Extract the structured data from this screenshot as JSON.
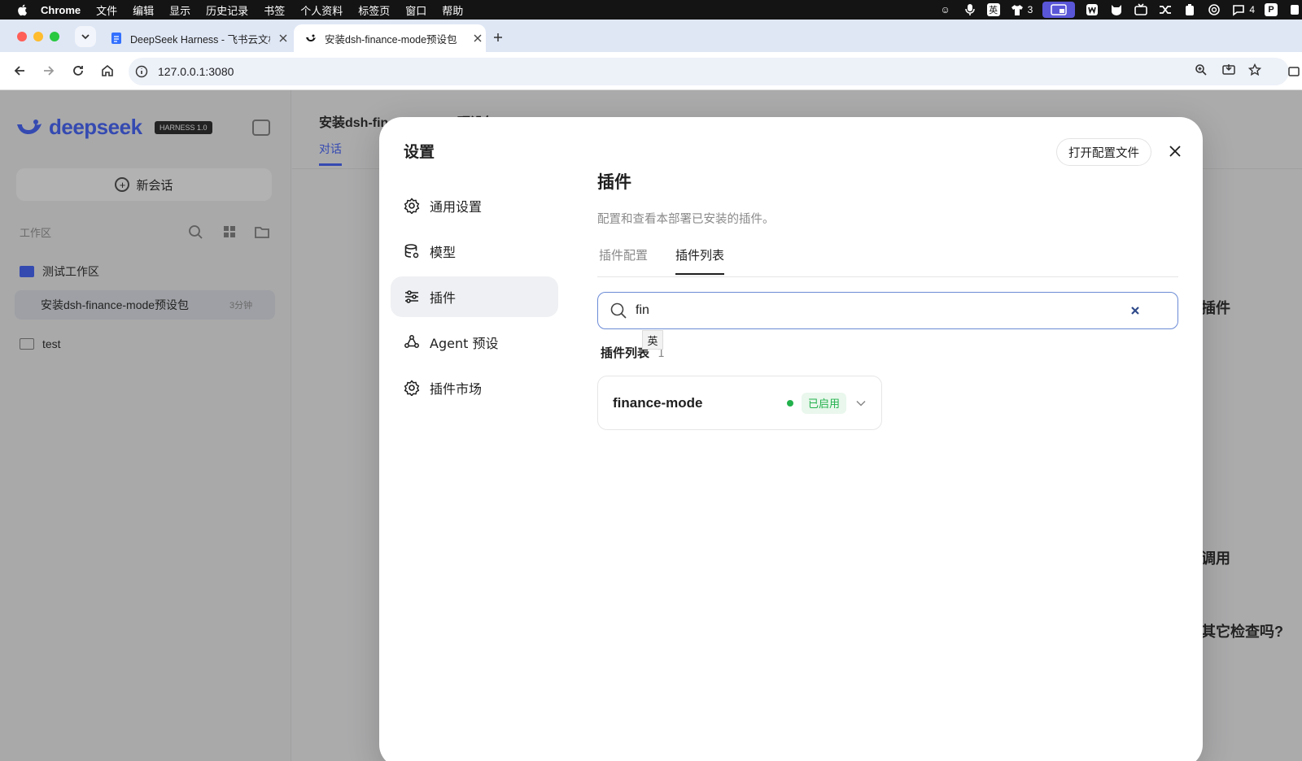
{
  "menubar": {
    "app": "Chrome",
    "items": [
      "文件",
      "编辑",
      "显示",
      "历史记录",
      "书签",
      "个人资料",
      "标签页",
      "窗口",
      "帮助"
    ],
    "status_count_a": "3",
    "status_count_b": "4",
    "ime_label": "英"
  },
  "browser": {
    "tabs": [
      {
        "title": "DeepSeek Harness - 飞书云文档",
        "active": false
      },
      {
        "title": "安装dsh-finance-mode预设包",
        "active": true
      }
    ],
    "url": "127.0.0.1:3080"
  },
  "app": {
    "logo": "deepseek",
    "badge": "HARNESS 1.0",
    "new_chat": "新会话",
    "workspace_label": "工作区",
    "folders": [
      "测试工作区",
      "test"
    ],
    "session": {
      "title": "安装dsh-finance-mode预设包",
      "time": "3分钟"
    },
    "main_title": "安装dsh-finance-mode预设包",
    "main_tab": "对话",
    "bg_fragments": [
      "插件",
      "调用",
      "其它检查吗?"
    ]
  },
  "settings": {
    "title": "设置",
    "open_config": "打开配置文件",
    "nav": [
      {
        "label": "通用设置",
        "icon": "gear-icon",
        "active": false
      },
      {
        "label": "模型",
        "icon": "database-icon",
        "active": false
      },
      {
        "label": "插件",
        "icon": "sliders-icon",
        "active": true
      },
      {
        "label": "Agent 预设",
        "icon": "agent-icon",
        "active": false
      },
      {
        "label": "插件市场",
        "icon": "gear-icon",
        "active": false
      }
    ],
    "section_title": "插件",
    "section_desc": "配置和查看本部署已安装的插件。",
    "subtabs": [
      "插件配置",
      "插件列表"
    ],
    "active_subtab": "插件列表",
    "search_value": "fin",
    "ime_hint": "英",
    "list_title": "插件列表",
    "list_count": "1",
    "plugins": [
      {
        "name": "finance-mode",
        "status": "已启用"
      }
    ]
  },
  "colors": {
    "accent": "#4d6bfe",
    "enabled_green": "#22b14c",
    "enabled_bg": "#e9f7ec"
  }
}
